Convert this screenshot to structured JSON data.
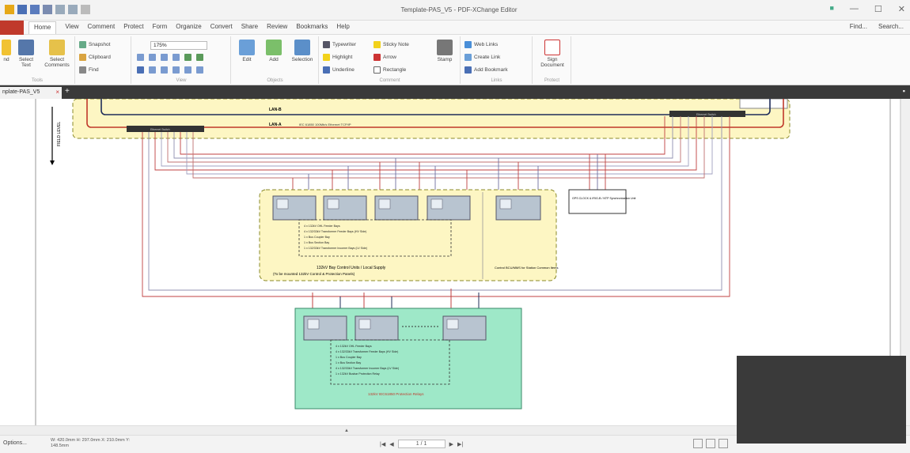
{
  "window": {
    "title": "Template-PAS_V5 - PDF-XChange Editor",
    "controls": [
      "—",
      "☐",
      "✕"
    ]
  },
  "menu": {
    "file_label": "",
    "items": [
      "Home",
      "View",
      "Comment",
      "Protect",
      "Form",
      "Organize",
      "Convert",
      "Share",
      "Review",
      "Bookmarks",
      "Help"
    ],
    "active": "Home",
    "find_label": "Find...",
    "search_label": "Search..."
  },
  "ribbon": {
    "tools": {
      "hand": "nd",
      "select_text": "Select Text",
      "select_comments": "Select Comments",
      "label": "Tools"
    },
    "clipboard": {
      "snapshot": "Snapshot",
      "clipboard": "Clipboard",
      "find": "Find"
    },
    "view": {
      "zoom": "175%",
      "label": "View"
    },
    "objects": {
      "edit": "Edit",
      "add": "Add",
      "selection": "Selection",
      "label": "Objects"
    },
    "comment": {
      "typewriter": "Typewriter",
      "sticky_note": "Sticky Note",
      "highlight": "Highlight",
      "arrow": "Arrow",
      "underline": "Underline",
      "rectangle": "Rectangle",
      "stamp": "Stamp",
      "label": "Comment"
    },
    "links": {
      "web_links": "Web Links",
      "create_link": "Create Link",
      "add_bookmark": "Add Bookmark",
      "label": "Links"
    },
    "protect": {
      "sign_document": "Sign Document",
      "label": "Protect"
    }
  },
  "tabs": {
    "doc_tab": "nplate-PAS_V5",
    "add_tab": "+"
  },
  "diagram": {
    "field_level": "FIELD LEVEL",
    "lan_b": "LAN-B",
    "lan_a": "LAN-A",
    "lan_a_desc": "IEC 61850 100Mb/s Ethernet TCP/IP",
    "switch_left": "Ethernet Switch",
    "switch_right": "Ethernet Switch",
    "control_group_list": [
      "4 x 132kV OHL Feeder Bays",
      "4 x 132/33kV Transformer Feeder Bays (HV Side)",
      "1 x Bus Coupler Bay",
      "1 x Bus Section Bay",
      "1 x 132/33kV Transformer Incomer Bays (LV Side)"
    ],
    "control_group_caption": "132kV Bay Control Units / Local Supply",
    "control_group_caption2": "(To be mounted 132kV Control & Protection Panels)",
    "right_group_caption": "Control BCU/MMS for Station Common Items",
    "gps_box": "GPS CLOCK & IRIG-B / NTP Synchronization Unit",
    "protection_list": [
      "4 x 132kV OHL Feeder Bays",
      "4 x 132/33kV Transformer Feeder Bays (HV Side)",
      "1 x Bus Coupler Bay",
      "1 x Bus Section Bay",
      "4 x 132/33kV Transformer Incomer Bays (LV Side)",
      "1 x 132kV Busbar Protection Relay"
    ],
    "protection_caption": "132kV IEC61850 Protection Relays"
  },
  "statusbar": {
    "options": "Options...",
    "dims": "W: 420.0mm  H: 297.0mm  X: 210.0mm  Y: 148.5mm",
    "page": "1 / 1"
  },
  "colors": {
    "accent_red": "#c0392b",
    "yellow_zone": "#fdf6c3",
    "green_zone": "#9ee8c8",
    "lan_red": "#c0392b",
    "lan_navy": "#1f2d5a"
  }
}
